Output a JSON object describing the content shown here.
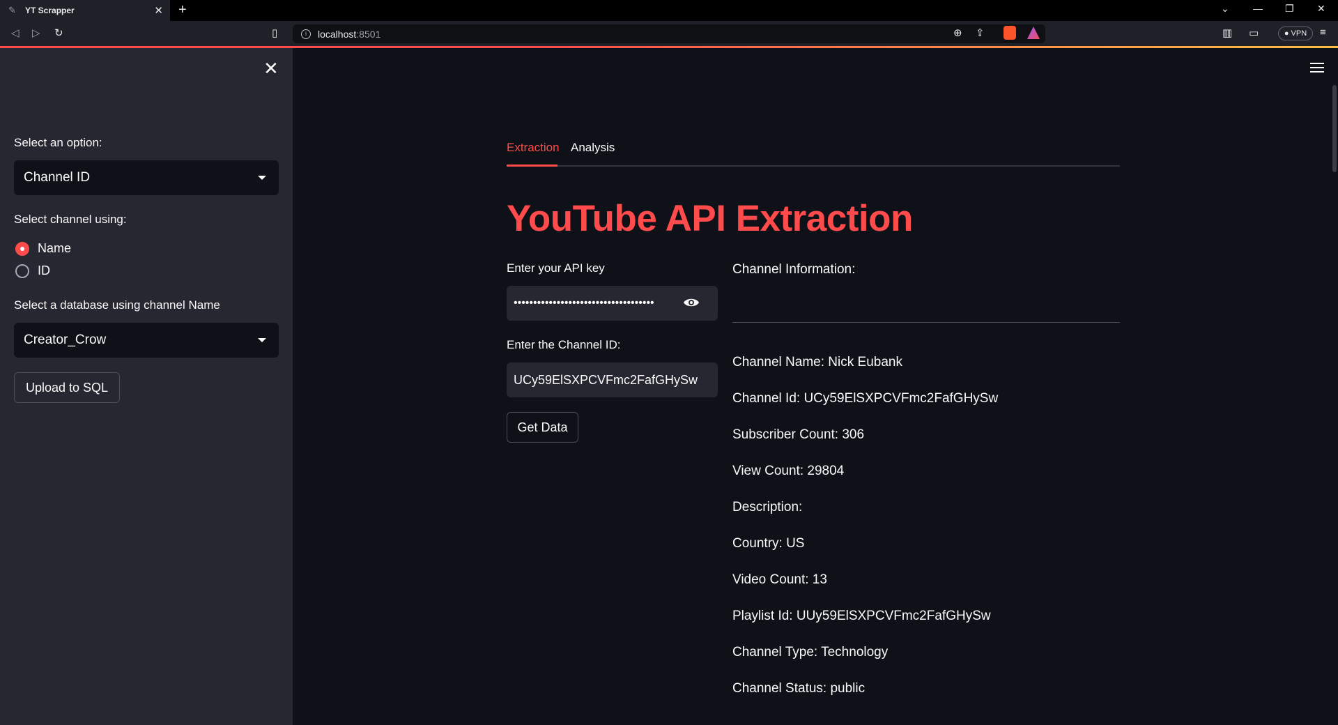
{
  "browser": {
    "tab_title": "YT Scrapper",
    "url_host": "localhost",
    "url_port": ":8501",
    "vpn_label": "VPN"
  },
  "sidebar": {
    "option_label": "Select an option:",
    "option_value": "Channel ID",
    "channel_using_label": "Select channel using:",
    "radio_options": [
      "Name",
      "ID"
    ],
    "radio_selected": "Name",
    "database_label": "Select a database using channel Name",
    "database_value": "Creator_Crow",
    "upload_button": "Upload to SQL"
  },
  "main": {
    "tabs": [
      {
        "label": "Extraction",
        "active": true
      },
      {
        "label": "Analysis",
        "active": false
      }
    ],
    "title": "YouTube API Extraction",
    "api_key_label": "Enter your API key",
    "api_key_value": "••••••••••••••••••••••••••••••••••••",
    "channel_id_label": "Enter the Channel ID:",
    "channel_id_value": "UCy59ElSXPCVFmc2FafGHySw",
    "get_data_button": "Get Data",
    "info_header": "Channel Information:",
    "info_lines": [
      "Channel Name: Nick Eubank",
      "Channel Id: UCy59ElSXPCVFmc2FafGHySw",
      "Subscriber Count: 306",
      "View Count: 29804",
      "Description:",
      "Country: US",
      "Video Count: 13",
      "Playlist Id: UUy59ElSXPCVFmc2FafGHySw",
      "Channel Type: Technology",
      "Channel Status: public"
    ]
  },
  "colors": {
    "accent": "#ff4b4b",
    "background": "#0e1117",
    "sidebar": "#262730"
  }
}
